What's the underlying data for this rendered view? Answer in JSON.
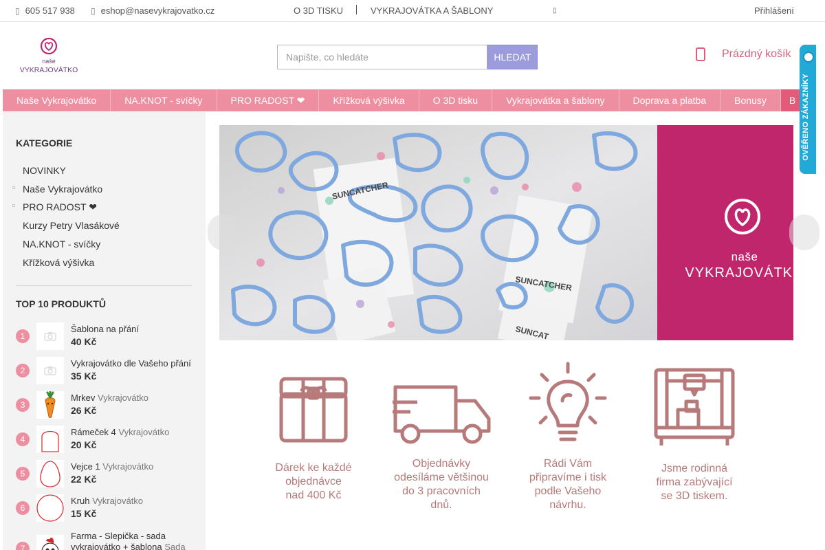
{
  "topbar": {
    "phone": "605 517 938",
    "email": "eshop@nasevykrajovatko.cz",
    "link_3d": "O 3D TISKU",
    "link_cutters": "VYKRAJOVÁTKA A ŠABLONY",
    "login": "Přihlášení"
  },
  "logo": {
    "line1": "naše",
    "line2": "VYKRAJOVÁTKO"
  },
  "search": {
    "placeholder": "Napište, co hledáte",
    "button": "HLEDAT"
  },
  "cart": {
    "label": "Prázdný košík"
  },
  "badge": {
    "text": "OVĚŘENO ZÁKAZNÍKY"
  },
  "nav": {
    "items": [
      "Naše Vykrajovátko",
      "NA.KNOT - svíčky",
      "PRO RADOST ❤",
      "Křížková výšivka",
      "O 3D tisku",
      "Vykrajovátka a šablony",
      "Doprava a platba",
      "Bonusy",
      "B"
    ]
  },
  "sidebar": {
    "categories_title": "KATEGORIE",
    "categories": [
      "NOVINKY",
      "Naše Vykrajovátko",
      "PRO RADOST ❤",
      "Kurzy Petry Vlasákové",
      "NA.KNOT - svíčky",
      "Křížková výšivka"
    ],
    "top_title": "TOP 10 PRODUKTŮ",
    "products": [
      {
        "rank": "1",
        "name": "Šablona na přání",
        "category": "",
        "price": "40 Kč"
      },
      {
        "rank": "2",
        "name": "Vykrajovátko dle Vašeho přání",
        "category": "",
        "price": "35 Kč"
      },
      {
        "rank": "3",
        "name": "Mrkev",
        "category": "Vykrajovátko",
        "price": "26 Kč"
      },
      {
        "rank": "4",
        "name": "Rámeček 4",
        "category": "Vykrajovátko",
        "price": "20 Kč"
      },
      {
        "rank": "5",
        "name": "Vejce 1",
        "category": "Vykrajovátko",
        "price": "22 Kč"
      },
      {
        "rank": "6",
        "name": "Kruh",
        "category": "Vykrajovátko",
        "price": "15 Kč"
      },
      {
        "rank": "7",
        "name": "Farma - Slepička - sada vykrajovátko + šablona",
        "category": "Sada",
        "price": ""
      }
    ]
  },
  "banner": {
    "words": [
      "SUNCATCHER",
      "SUNCATCHER",
      "SUNCAT"
    ],
    "brand_small": "naše",
    "brand_big": "VYKRAJOVÁTKO"
  },
  "features": [
    {
      "icon": "gift-icon",
      "lines": [
        "Dárek ke každé",
        "objednávce",
        "nad 400 Kč"
      ]
    },
    {
      "icon": "truck-icon",
      "lines": [
        "Objednávky",
        "odesíláme většinou",
        "do 3 pracovních",
        "dnů."
      ]
    },
    {
      "icon": "lightbulb-icon",
      "lines": [
        "Rádi Vám",
        "připravíme i tisk",
        "podle Vašeho",
        "návrhu."
      ]
    },
    {
      "icon": "3d-printer-icon",
      "lines": [
        "Jsme rodinná",
        "firma zabývající",
        "se 3D tiskem."
      ]
    }
  ],
  "colors": {
    "accent_pink": "#ee8fa1",
    "brand_magenta": "#c0266c",
    "search_button": "#9c9cdd",
    "feature_icon": "#b57a79",
    "badge_blue": "#21a9d8"
  }
}
